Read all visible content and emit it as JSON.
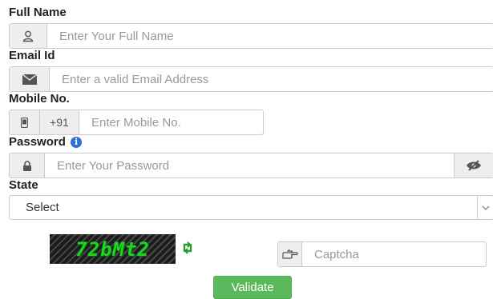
{
  "full_name": {
    "label": "Full Name",
    "placeholder": "Enter Your Full Name",
    "icon": "user-icon"
  },
  "email": {
    "label": "Email Id",
    "placeholder": "Enter a valid Email Address",
    "icon": "envelope-icon"
  },
  "mobile": {
    "label": "Mobile No.",
    "country_code": "+91",
    "placeholder": "Enter Mobile No.",
    "icon": "mobile-phone-icon"
  },
  "password": {
    "label": "Password",
    "info_glyph": "i",
    "placeholder": "Enter Your Password",
    "icon": "lock-icon",
    "toggle_icon": "eye-slash-icon"
  },
  "state": {
    "label": "State",
    "selected": "Select"
  },
  "captcha": {
    "text": "72bMt2",
    "refresh_icon": "refresh-icon",
    "placeholder": "Captcha",
    "icon": "hand-point-right-icon"
  },
  "validate_button": "Validate",
  "colors": {
    "button": "#5cb85c",
    "captcha_text": "#19d81f",
    "info_icon": "#2f6fd0"
  }
}
